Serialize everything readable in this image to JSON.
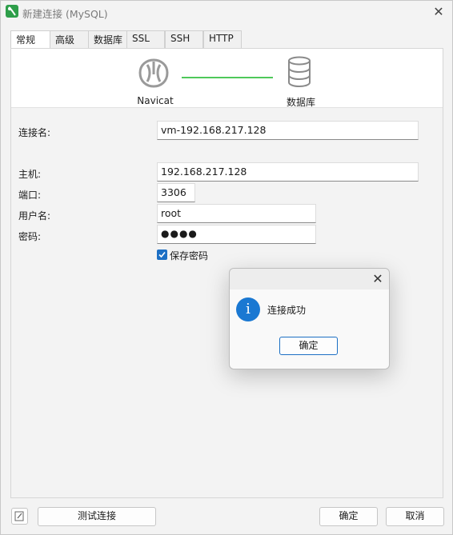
{
  "window": {
    "title": "新建连接 (MySQL)"
  },
  "tabs": [
    "常规",
    "高级",
    "数据库",
    "SSL",
    "SSH",
    "HTTP"
  ],
  "active_tab": "常规",
  "banner": {
    "left_label": "Navicat",
    "right_label": "数据库",
    "link_color": "#4ec85a"
  },
  "form": {
    "connection_name_label": "连接名:",
    "connection_name_value": "vm-192.168.217.128",
    "host_label": "主机:",
    "host_value": "192.168.217.128",
    "port_label": "端口:",
    "port_value": "3306",
    "username_label": "用户名:",
    "username_value": "root",
    "password_label": "密码:",
    "password_mask": "●●●●",
    "save_password_label": "保存密码",
    "save_password_checked": true
  },
  "footer": {
    "test_button": "测试连接",
    "ok_button": "确定",
    "cancel_button": "取消"
  },
  "dialog": {
    "message": "连接成功",
    "ok_button": "确定",
    "icon": "info-icon",
    "icon_glyph": "i",
    "accent": "#1a78d2"
  }
}
